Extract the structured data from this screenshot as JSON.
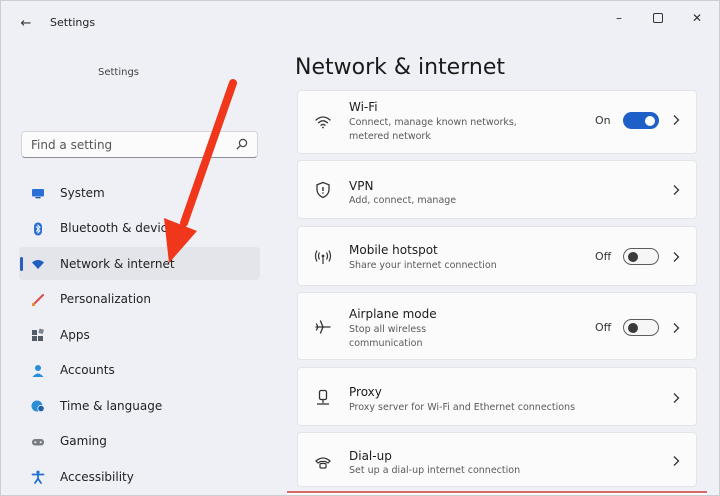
{
  "window": {
    "title": "Settings",
    "back_glyph": "←",
    "minimize_glyph": "–",
    "close_glyph": "✕"
  },
  "sidebar": {
    "heading": "Settings",
    "search": {
      "placeholder": "Find a setting",
      "icon": "search-icon"
    },
    "items": [
      {
        "label": "System",
        "icon": "monitor-icon",
        "color": "#2a6fd6"
      },
      {
        "label": "Bluetooth & devices",
        "icon": "bluetooth-icon",
        "color": "#2a6fd6"
      },
      {
        "label": "Network & internet",
        "icon": "wifi-icon",
        "color": "#1f5fbf",
        "active": true
      },
      {
        "label": "Personalization",
        "icon": "brush-icon",
        "color": "#d9534f"
      },
      {
        "label": "Apps",
        "icon": "apps-icon",
        "color": "#555b66"
      },
      {
        "label": "Accounts",
        "icon": "person-icon",
        "color": "#2a8fd6"
      },
      {
        "label": "Time & language",
        "icon": "globe-clock-icon",
        "color": "#2a8fd6"
      },
      {
        "label": "Gaming",
        "icon": "gamepad-icon",
        "color": "#777c85"
      },
      {
        "label": "Accessibility",
        "icon": "accessibility-icon",
        "color": "#1f6fd0"
      }
    ]
  },
  "main": {
    "title": "Network & internet",
    "cards": [
      {
        "title": "Wi-Fi",
        "description": "Connect, manage known networks, metered network",
        "icon": "wifi-icon",
        "toggle_label": "On",
        "toggle_state": "on"
      },
      {
        "title": "VPN",
        "description": "Add, connect, manage",
        "icon": "shield-icon"
      },
      {
        "title": "Mobile hotspot",
        "description": "Share your internet connection",
        "icon": "hotspot-icon",
        "toggle_label": "Off",
        "toggle_state": "off"
      },
      {
        "title": "Airplane mode",
        "description": "Stop all wireless communication",
        "icon": "airplane-icon",
        "toggle_label": "Off",
        "toggle_state": "off"
      },
      {
        "title": "Proxy",
        "description": "Proxy server for Wi-Fi and Ethernet connections",
        "icon": "proxy-icon"
      },
      {
        "title": "Dial-up",
        "description": "Set up a dial-up internet connection",
        "icon": "dialup-icon"
      }
    ]
  },
  "colors": {
    "accent": "#1e5fc8",
    "annotation_arrow": "#f0361b"
  }
}
